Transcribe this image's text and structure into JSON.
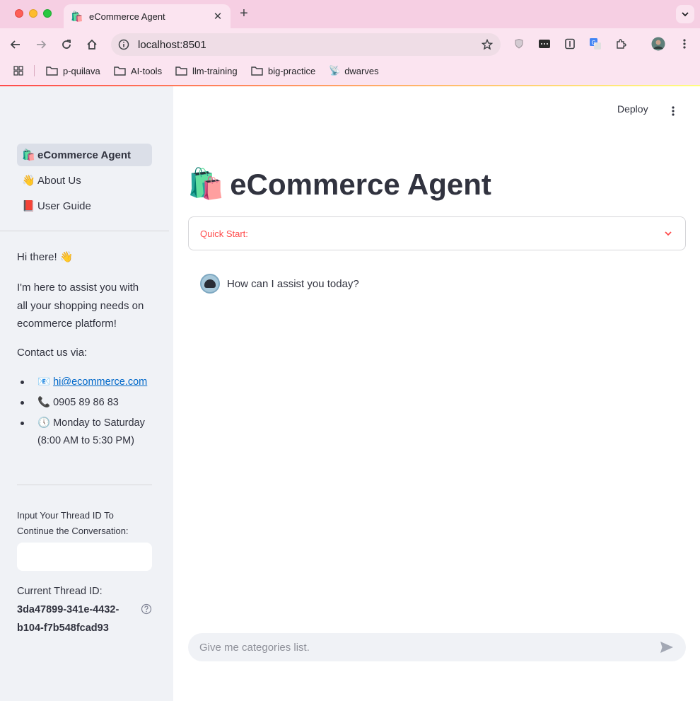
{
  "browser": {
    "tab": {
      "favicon": "🛍️",
      "title": "eCommerce Agent"
    },
    "url": "localhost:8501",
    "bookmarks": [
      {
        "label": "p-quilava",
        "icon": "folder-icon"
      },
      {
        "label": "AI-tools",
        "icon": "folder-icon"
      },
      {
        "label": "llm-training",
        "icon": "folder-icon"
      },
      {
        "label": "big-practice",
        "icon": "folder-icon"
      },
      {
        "label": "dwarves",
        "icon": "satellite-icon"
      }
    ]
  },
  "sidebar": {
    "nav": [
      {
        "emoji": "🛍️",
        "label": "eCommerce Agent",
        "active": true
      },
      {
        "emoji": "👋",
        "label": "About Us",
        "active": false
      },
      {
        "emoji": "📕",
        "label": "User Guide",
        "active": false
      }
    ],
    "greeting": "Hi there! 👋",
    "intro": "I'm here to assist you with all your shopping needs on ecommerce platform!",
    "contact_title": "Contact us via:",
    "contacts": [
      {
        "emoji": "📧",
        "text": "hi@ecommerce.com",
        "link": true
      },
      {
        "emoji": "📞",
        "text": "0905 89 86 83",
        "link": false
      },
      {
        "emoji": "🕔",
        "text": "Monday to Saturday (8:00 AM to 5:30 PM)",
        "link": false
      }
    ],
    "thread_input_label": "Input Your Thread ID To Continue the Conversation:",
    "thread_input_value": "",
    "current_thread_label": "Current Thread ID:",
    "current_thread_id": "3da47899-341e-4432-b104-f7b548fcad93"
  },
  "main": {
    "deploy_label": "Deploy",
    "title_emoji": "🛍️",
    "title": "eCommerce Agent",
    "quick_start_label": "Quick Start:",
    "messages": [
      {
        "role": "assistant",
        "text": "How can I assist you today?"
      }
    ],
    "chat_input_placeholder": "Give me categories list."
  },
  "colors": {
    "accent": "#ff4b4b",
    "sidebar_bg": "#f0f2f6",
    "link": "#0068c9",
    "text": "#31333f"
  }
}
